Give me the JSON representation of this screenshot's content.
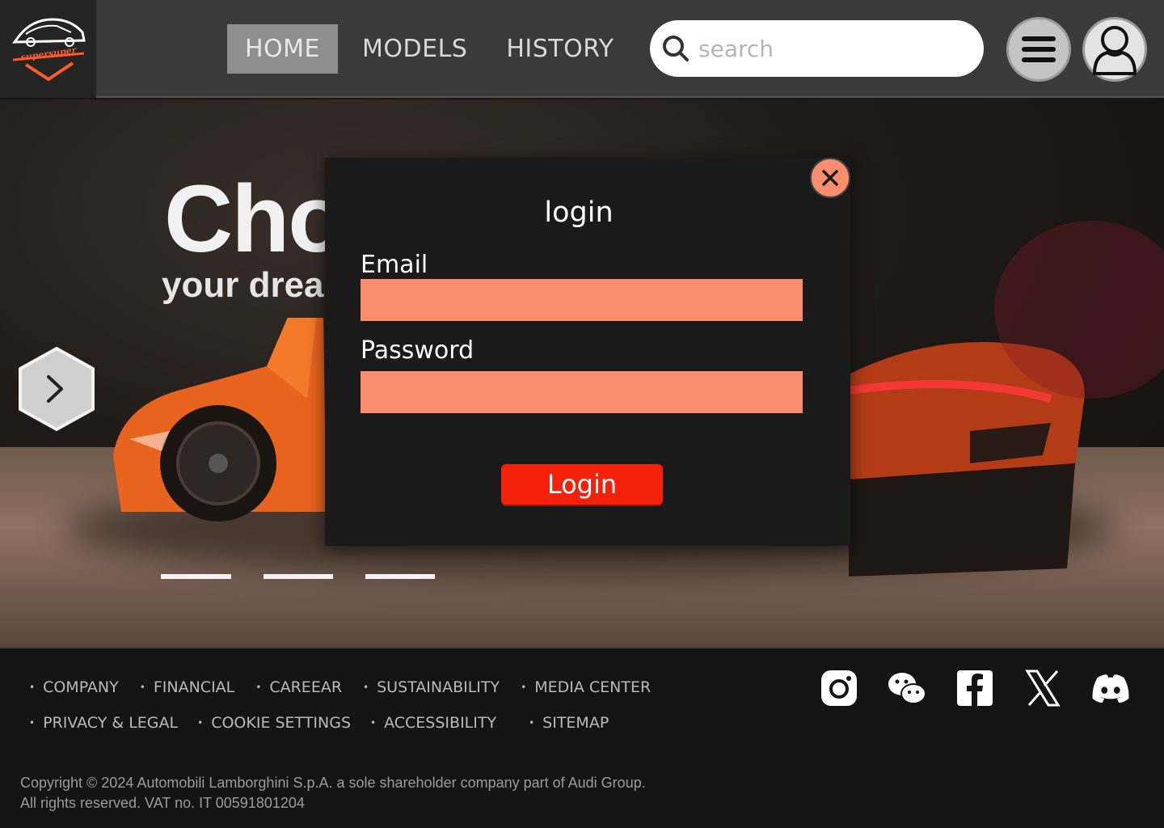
{
  "header": {
    "logo_text": "supersuper",
    "nav": [
      {
        "label": "HOME",
        "active": true
      },
      {
        "label": "MODELS",
        "active": false
      },
      {
        "label": "HISTORY",
        "active": false
      }
    ],
    "search": {
      "placeholder": "search",
      "value": ""
    },
    "menu_icon": "hamburger-icon",
    "user_icon": "user-icon"
  },
  "hero": {
    "title": "Cho",
    "subtitle": "your drea",
    "next_icon": "chevron-right-icon",
    "slides": 3
  },
  "modal": {
    "title": "login",
    "email_label": "Email",
    "email_value": "",
    "password_label": "Password",
    "password_value": "",
    "submit_label": "Login",
    "close_icon": "close-icon"
  },
  "footer": {
    "links_row1": [
      "COMPANY",
      "FINANCIAL",
      "CAREEAR",
      "SUSTAINABILITY",
      "MEDIA CENTER"
    ],
    "links_row2": [
      "PRIVACY & LEGAL",
      "COOKIE SETTINGS",
      "ACCESSIBILITY",
      "SITEMAP"
    ],
    "socials": [
      "instagram-icon",
      "wechat-icon",
      "facebook-icon",
      "x-icon",
      "discord-icon"
    ],
    "copyright_line1": "Copyright © 2024 Automobili Lamborghini S.p.A. a sole shareholder company part of Audi Group.",
    "copyright_line2": "All rights reserved. VAT no. IT 00591801204"
  },
  "colors": {
    "accent_salmon": "#fa8d6e",
    "login_red": "#f5200a",
    "header_bg": "#3a3a3a",
    "modal_bg": "#1a1a1a"
  }
}
